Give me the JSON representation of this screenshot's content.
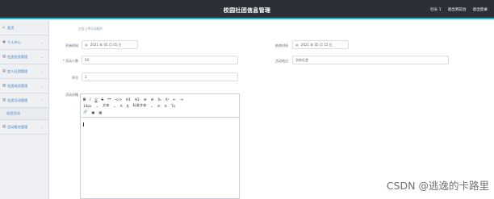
{
  "header": {
    "title": "校园社团信息管理",
    "user": "社长 1",
    "back_home": "退出到前台",
    "logout": "退出登录"
  },
  "sidebar": {
    "items": [
      {
        "label": "首页",
        "icon": "home-icon",
        "has_children": false
      },
      {
        "label": "个人中心",
        "icon": "user-icon",
        "has_children": true
      },
      {
        "label": "社团信息管理",
        "icon": "grid-icon",
        "has_children": true
      },
      {
        "label": "加入社团管理",
        "icon": "grid-icon",
        "has_children": true
      },
      {
        "label": "社团成员管理",
        "icon": "grid-icon",
        "has_children": true
      },
      {
        "label": "社团活动管理",
        "icon": "grid-icon",
        "has_children": true,
        "expanded": true
      }
    ],
    "active_sub": "社团活动",
    "last_item": {
      "label": "活动报名管理",
      "icon": "grid-icon",
      "has_children": true
    }
  },
  "breadcrumb": "点击上传活动图片",
  "form": {
    "start_time_label": "开始时间",
    "start_time_value": "2021 年 05 月 05 日",
    "end_time_label": "结束时间",
    "end_time_value": "2021 年 05 月 15 日",
    "capacity_label": "* 活动人数",
    "capacity_value": "50",
    "location_label": "活动地点",
    "location_value": "学校礼堂",
    "number_label": "序号",
    "number_value": "1",
    "details_label": "活动详情"
  },
  "editor": {
    "row1": [
      "B",
      "I",
      "U",
      "S",
      "❝❞",
      "</>",
      "H1",
      "H2",
      "☰",
      "☰",
      "X₂",
      "X²",
      "⇤",
      "⇥"
    ],
    "row2": [
      "14px",
      "⌄",
      "文本",
      "⌄",
      "A",
      "A̲",
      "标准字体",
      "⌄",
      "≡",
      "≡",
      "Tx"
    ],
    "row3": [
      "🔗",
      "▣",
      "▦"
    ]
  },
  "watermark": "CSDN @逃逸的卡路里"
}
